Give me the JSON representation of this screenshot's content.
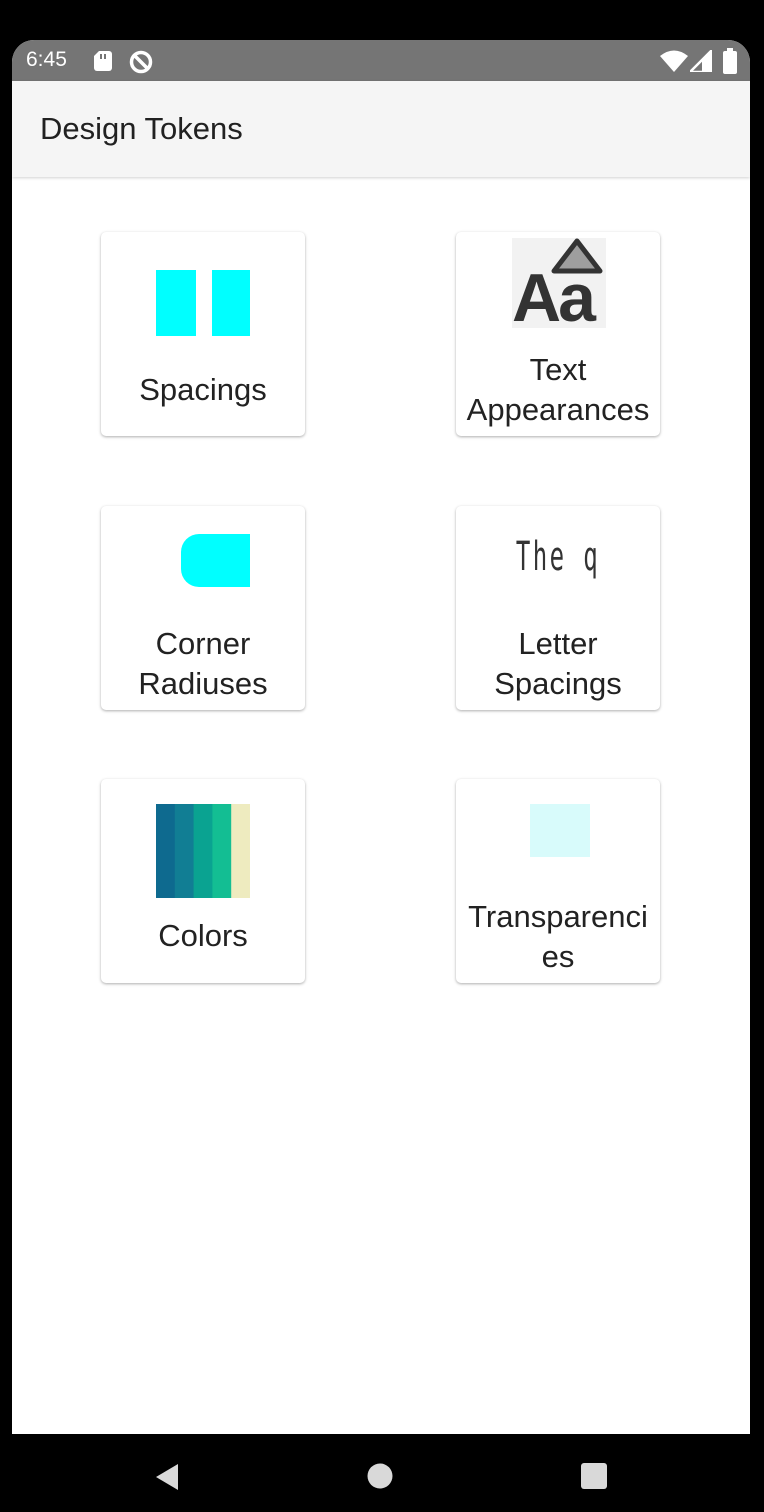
{
  "status_bar": {
    "time": "6:45",
    "left_icons": [
      "sd-card-icon",
      "data-saver-icon"
    ],
    "right_icons": [
      "wifi-icon",
      "cell-signal-icon",
      "battery-icon"
    ]
  },
  "app_bar": {
    "title": "Design Tokens"
  },
  "cards": [
    {
      "label": "Spacings",
      "icon": "spacings-icon",
      "color": "#00FFFF"
    },
    {
      "label": "Text\nAppearances",
      "icon": "text-appearance-icon",
      "icon_text": "Aa"
    },
    {
      "label": "Corner\nRadiuses",
      "icon": "corner-radius-icon",
      "color": "#00FFFF"
    },
    {
      "label": "Letter\nSpacings",
      "icon": "letter-spacing-icon",
      "icon_text": "The q"
    },
    {
      "label": "Colors",
      "icon": "color-palette-icon",
      "palette": [
        "#0E6A8F",
        "#117E94",
        "#0AA391",
        "#13BE93",
        "#EEEBBF"
      ]
    },
    {
      "label": "Transparenci\nes",
      "icon": "transparency-icon",
      "color": "#D8FBFB"
    }
  ],
  "nav_bar": {
    "buttons": [
      "back-button",
      "home-button",
      "recents-button"
    ]
  }
}
